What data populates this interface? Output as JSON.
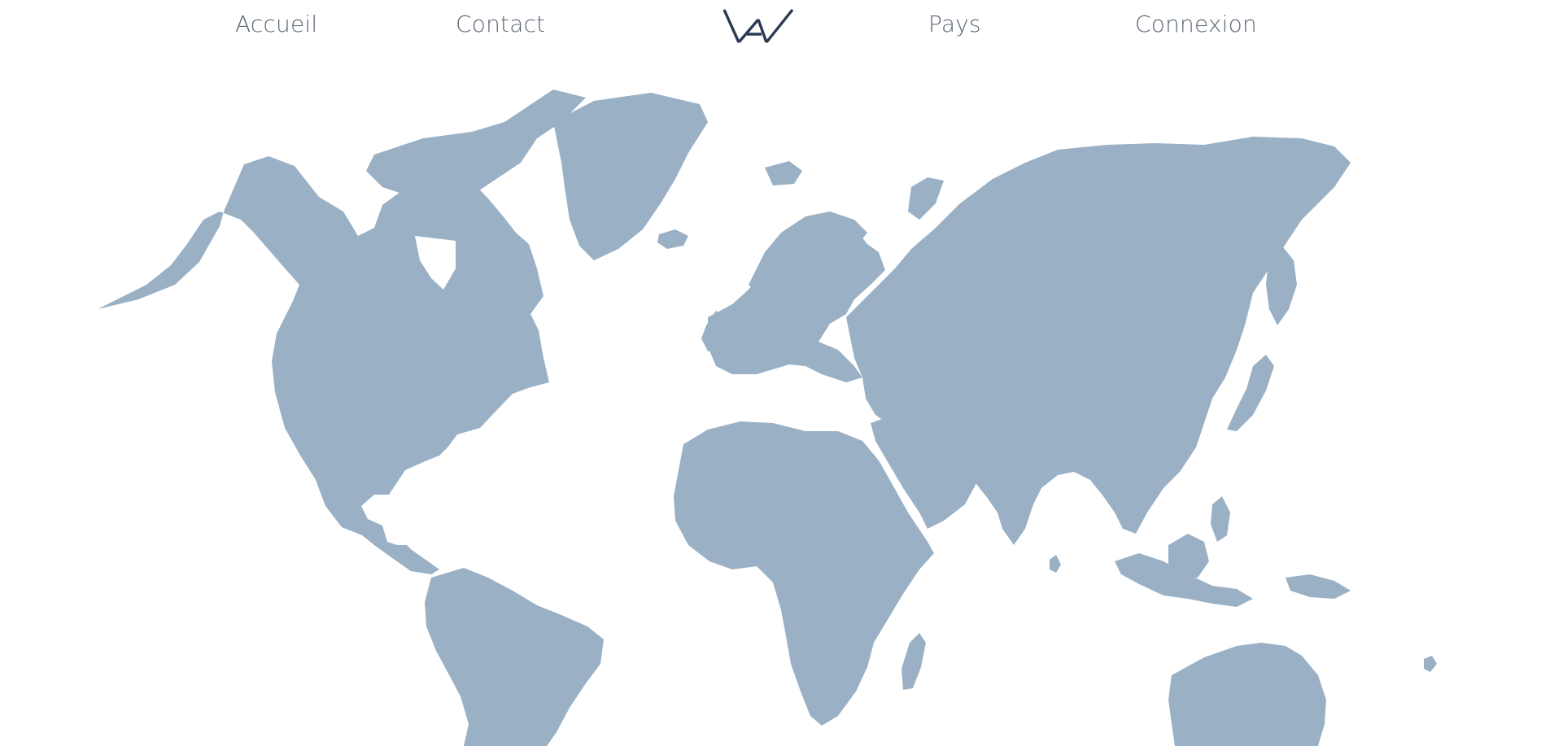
{
  "nav": {
    "items": [
      {
        "label": "Accueil"
      },
      {
        "label": "Contact"
      },
      {
        "label": "Pays"
      },
      {
        "label": "Connexion"
      }
    ],
    "logo": {
      "icon": "vav-logo-icon",
      "color": "#2a3a52"
    }
  },
  "map": {
    "icon": "world-map",
    "land_color": "#9ab1c5",
    "regions": [
      "North America",
      "Greenland",
      "South America",
      "Europe",
      "Africa",
      "Asia",
      "Australia",
      "Madagascar",
      "Iceland",
      "Japan",
      "Indonesia",
      "New Guinea",
      "UK"
    ]
  },
  "colors": {
    "text": "#5b6675",
    "background": "#ffffff"
  }
}
